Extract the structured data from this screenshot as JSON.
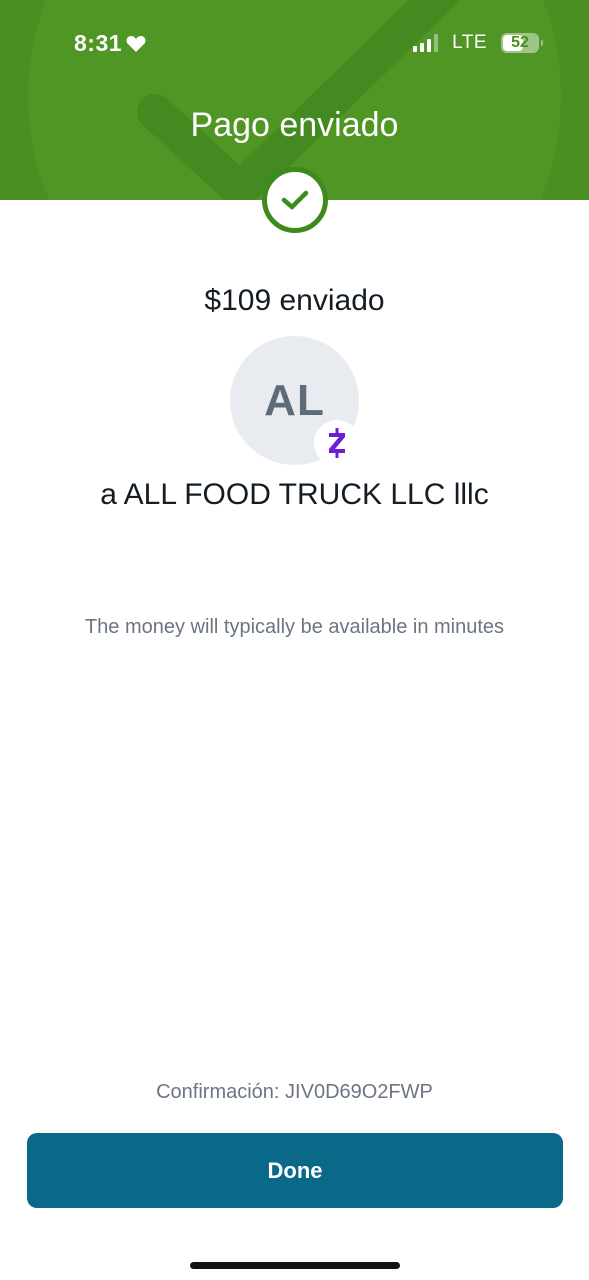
{
  "status_bar": {
    "time": "8:31",
    "network": "LTE",
    "battery": "52",
    "battery_level_percent": 52,
    "signal_strength_bars": 3,
    "heart_icon": "heart-icon"
  },
  "header": {
    "title": "Pago enviado",
    "background_color": "#4a8f22",
    "success_icon": "checkmark-icon"
  },
  "payment": {
    "amount_text": "$109 enviado",
    "recipient_initials": "AL",
    "recipient_text": "a ALL FOOD TRUCK LLC lllc",
    "payment_network_icon": "zelle-icon",
    "note": "The money will typically be available in minutes",
    "confirmation": "Confirmación: JIV0D69O2FWP"
  },
  "actions": {
    "done_label": "Done",
    "done_color": "#0a6989"
  },
  "colors": {
    "zelle_purple": "#6d1ed4",
    "text_primary": "#141c24",
    "text_secondary": "#6b7682"
  }
}
